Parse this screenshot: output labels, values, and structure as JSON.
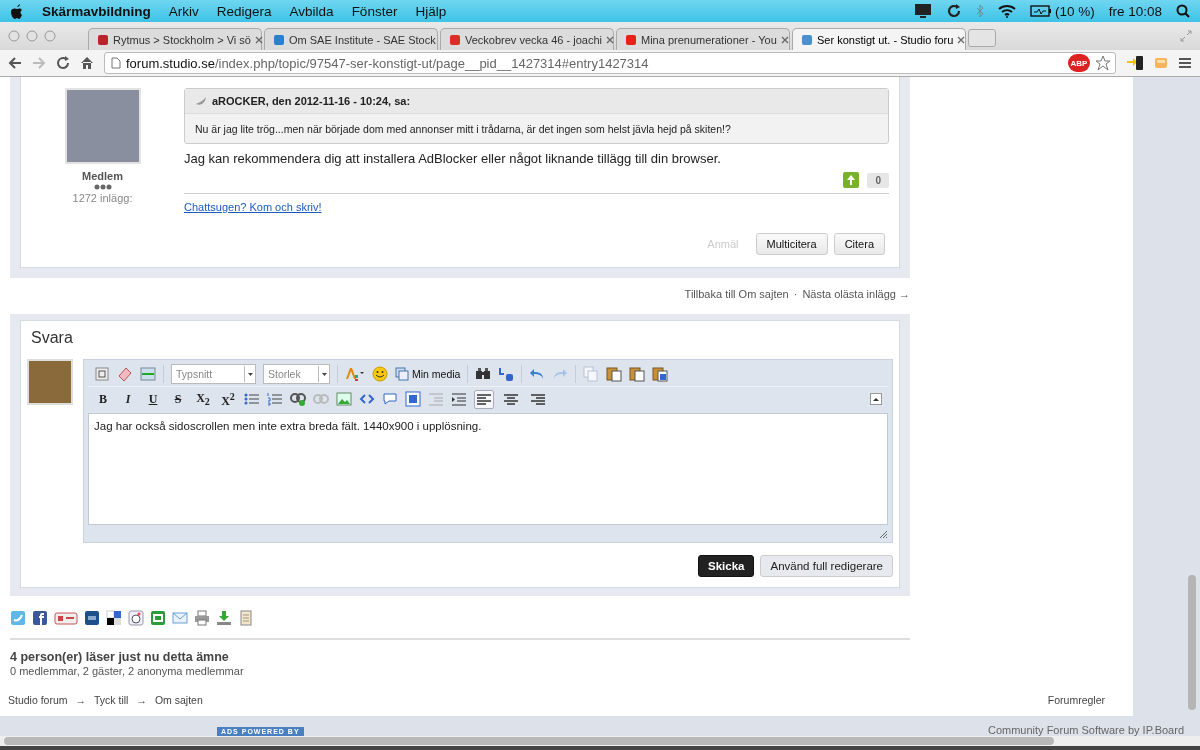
{
  "menubar": {
    "app": "Skärmavbildning",
    "menus": [
      "Arkiv",
      "Redigera",
      "Avbilda",
      "Fönster",
      "Hjälp"
    ],
    "battery": "(10 %)",
    "clock": "fre 10:08"
  },
  "tabs": [
    {
      "title": "Rytmus > Stockholm > Vi sö",
      "color": "#c0202a",
      "selected": false
    },
    {
      "title": "Om SAE Institute - SAE Stock",
      "color": "#2a7fd0",
      "selected": false
    },
    {
      "title": "Veckobrev vecka 46 - joachi",
      "color": "#d93025",
      "selected": false
    },
    {
      "title": "Mina prenumerationer - You",
      "color": "#e62117",
      "selected": false
    },
    {
      "title": "Ser konstigt ut. - Studio foru",
      "color": "#4a8fd0",
      "selected": true
    }
  ],
  "address": {
    "host": "forum.studio.se",
    "path": "/index.php/topic/97547-ser-konstigt-ut/page__pid__1427314#entry1427314",
    "adblock_badge": "ABP"
  },
  "post": {
    "author_group": "Medlem",
    "post_count": "1272 inlägg:",
    "quote": {
      "header": "aROCKER, den 2012-11-16 - 10:24, sa:",
      "text": "Nu är jag lite trög...men när började dom med annonser mitt i trådarna, är det ingen som helst jävla hejd på skiten!?"
    },
    "text": "Jag kan rekommendera dig att installera AdBlocker eller något liknande tillägg till din browser.",
    "reputation": "0",
    "signature": "Chattsugen? Kom och skriv!",
    "buttons": [
      {
        "label": "Anmäl",
        "disabled": true
      },
      {
        "label": "Multicitera",
        "disabled": false
      },
      {
        "label": "Citera",
        "disabled": false
      }
    ]
  },
  "topic_nav": {
    "back": "Tillbaka till Om sajten",
    "separator": "·",
    "next": "Nästa olästa inlägg →"
  },
  "reply": {
    "title": "Svara",
    "editor": {
      "font_select": "Typsnitt",
      "size_select": "Storlek",
      "media_button": "Min media",
      "format_buttons": [
        "B",
        "I",
        "U",
        "S",
        "X$_{2}$",
        "X$^{2}$"
      ],
      "alignment_buttons": [
        {
          "selected": true
        },
        {
          "selected": false
        },
        {
          "selected": false
        }
      ],
      "value": "Jag har också sidoscrollen men inte extra breda fält. 1440x900 i upplösning."
    },
    "buttons": [
      "Skicka",
      "Använd full redigerare"
    ]
  },
  "viewers": {
    "title": "4 person(er) läser just nu detta ämne",
    "detail": "0 medlemmar, 2 gäster, 2 anonyma medlemmar"
  },
  "breadcrumb": {
    "items": [
      "Studio forum",
      "Tyck till",
      "Om sajten"
    ],
    "separator": "→"
  },
  "forum_rules": "Forumregler",
  "footer": {
    "ads_badge": "ADS POWERED BY",
    "credit": "Community Forum Software by IP.Board"
  }
}
